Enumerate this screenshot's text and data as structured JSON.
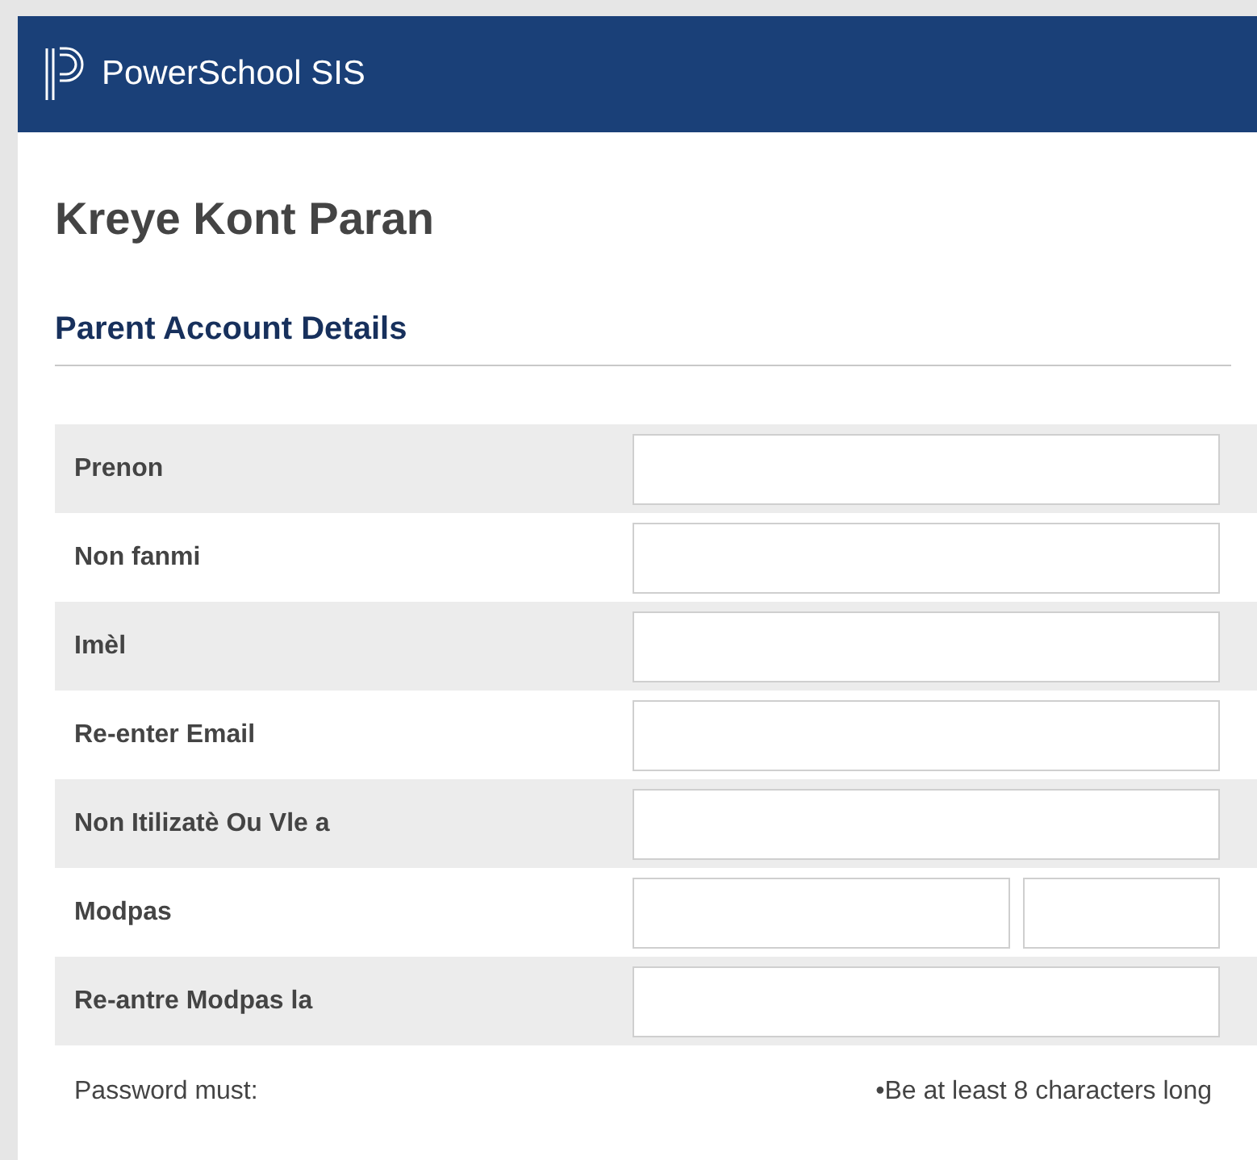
{
  "header": {
    "product": "PowerSchool SIS"
  },
  "page_title": "Kreye Kont Paran",
  "section_title": "Parent Account Details",
  "fields": [
    {
      "label": "Prenon",
      "kind": "single"
    },
    {
      "label": "Non fanmi",
      "kind": "single"
    },
    {
      "label": "Imèl",
      "kind": "single"
    },
    {
      "label": "Re-enter Email",
      "kind": "single"
    },
    {
      "label": "Non Itilizatè Ou Vle a",
      "kind": "single"
    },
    {
      "label": "Modpas",
      "kind": "split"
    },
    {
      "label": "Re-antre Modpas la",
      "kind": "single"
    }
  ],
  "password_rules": {
    "label": "Password must:",
    "rules": [
      "•Be at least 8 characters long"
    ]
  }
}
